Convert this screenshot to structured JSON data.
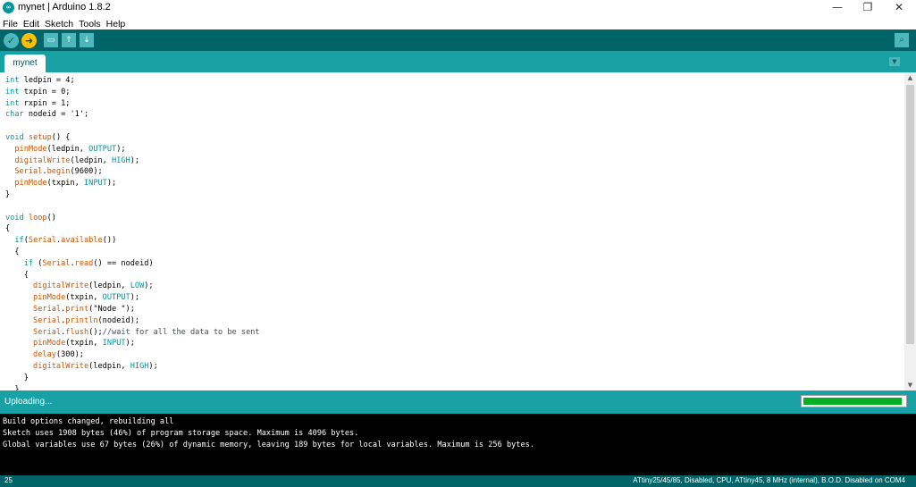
{
  "window": {
    "title": "mynet | Arduino 1.8.2",
    "icon": "arduino-logo-icon",
    "controls": {
      "minimize": "—",
      "maximize": "❐",
      "close": "✕"
    }
  },
  "menu": [
    "File",
    "Edit",
    "Sketch",
    "Tools",
    "Help"
  ],
  "toolbar": {
    "verify": "✓",
    "upload": "➜",
    "new": "▭",
    "open": "↑",
    "save": "↓",
    "monitor": "⌕",
    "icons": [
      "verify-icon",
      "upload-icon",
      "new-icon",
      "open-icon",
      "save-icon",
      "serial-monitor-icon"
    ]
  },
  "tabs": [
    {
      "label": "mynet"
    }
  ],
  "tab_menu": "▼",
  "editor": {
    "lines": [
      "int ledpin = 4;",
      "int txpin = 0;",
      "int rxpin = 1;",
      "char nodeid = '1';",
      "",
      "void setup() {",
      "  pinMode(ledpin, OUTPUT);",
      "  digitalWrite(ledpin, HIGH);",
      "  Serial.begin(9600);",
      "  pinMode(txpin, INPUT);",
      "}",
      "",
      "void loop()",
      "{",
      "  if(Serial.available())",
      "  {",
      "    if (Serial.read() == nodeid)",
      "    {",
      "      digitalWrite(ledpin, LOW);",
      "      pinMode(txpin, OUTPUT);",
      "      Serial.print(\"Node \");",
      "      Serial.println(nodeid);",
      "      Serial.flush();//wait for all the data to be sent",
      "      pinMode(txpin, INPUT);",
      "      delay(300);",
      "      digitalWrite(ledpin, HIGH);",
      "    }",
      "  }"
    ]
  },
  "scrollbar": {
    "up": "▲",
    "down": "▼"
  },
  "status": {
    "text": "Uploading...",
    "progress": 0.97,
    "progress_color": "#06b025"
  },
  "console": {
    "lines": [
      "Build options changed, rebuilding all",
      "Sketch uses 1908 bytes (46%) of program storage space. Maximum is 4096 bytes.",
      "Global variables use 67 bytes (26%) of dynamic memory, leaving 189 bytes for local variables. Maximum is 256 bytes."
    ]
  },
  "footer": {
    "line_number": "25",
    "board": "ATtiny25/45/85, Disabled, CPU, ATtiny45, 8 MHz (internal), B.O.D. Disabled on COM4"
  },
  "colors": {
    "toolbar": "#006468",
    "tabbar": "#17a1a5",
    "keyword": "#00979c",
    "function": "#d35400",
    "upload_button": "#ffc107"
  }
}
